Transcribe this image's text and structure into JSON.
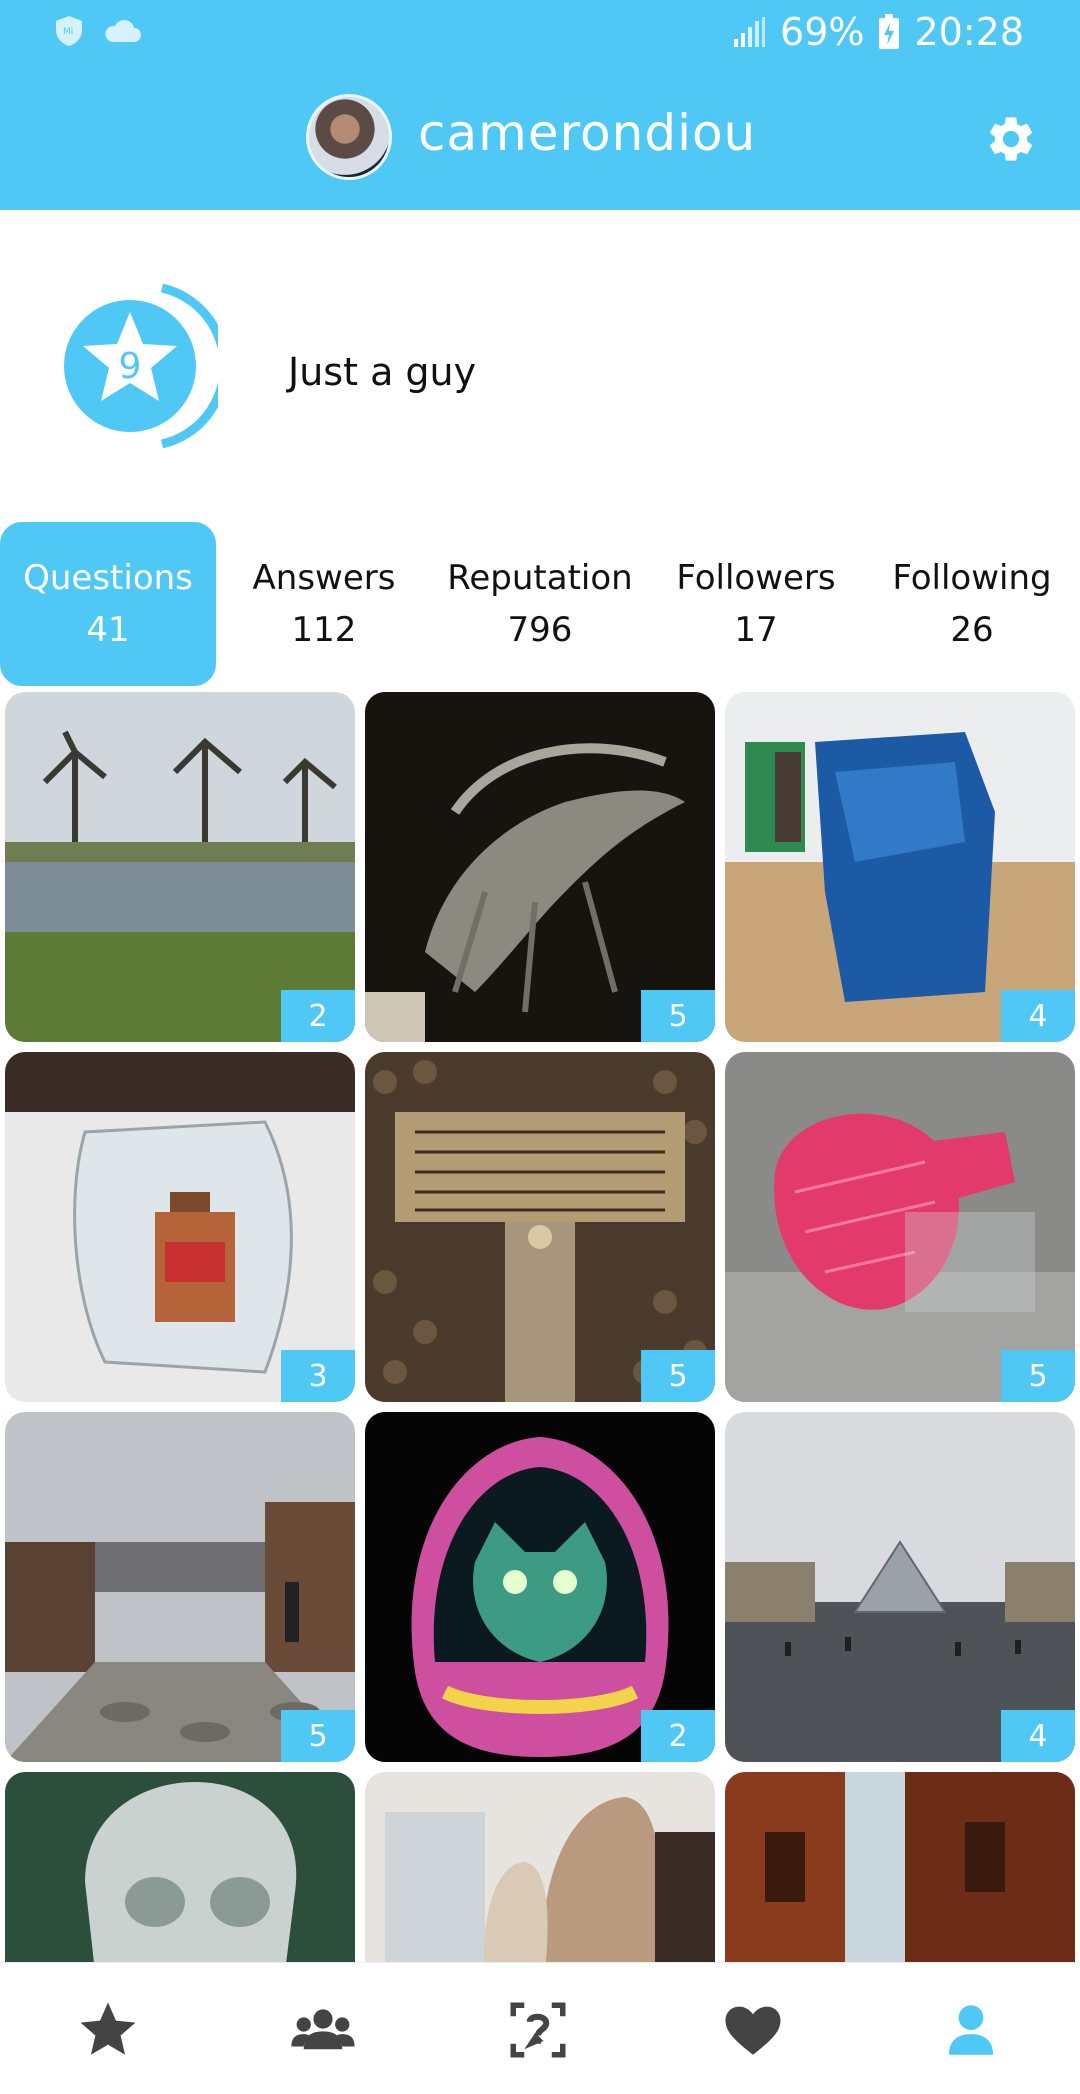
{
  "status_bar": {
    "battery": "69%",
    "time": "20:28",
    "icons": [
      "shield-icon",
      "cloud-icon",
      "signal-icon",
      "battery-icon"
    ]
  },
  "header": {
    "username": "camerondiou",
    "settings_icon": "gear-icon"
  },
  "profile": {
    "level": "9",
    "bio": "Just a guy"
  },
  "stats": [
    {
      "label": "Questions",
      "value": "41"
    },
    {
      "label": "Answers",
      "value": "112"
    },
    {
      "label": "Reputation",
      "value": "796"
    },
    {
      "label": "Followers",
      "value": "17"
    },
    {
      "label": "Following",
      "value": "26"
    }
  ],
  "grid": [
    {
      "count": "2"
    },
    {
      "count": "5"
    },
    {
      "count": "4"
    },
    {
      "count": "3"
    },
    {
      "count": "5"
    },
    {
      "count": "5"
    },
    {
      "count": "5"
    },
    {
      "count": "2"
    },
    {
      "count": "4"
    }
  ],
  "bottom_nav": [
    "star-icon",
    "community-icon",
    "question-frame-icon",
    "heart-icon",
    "profile-icon"
  ],
  "colors": {
    "accent": "#50c8f5",
    "inactive_nav": "#444444"
  }
}
